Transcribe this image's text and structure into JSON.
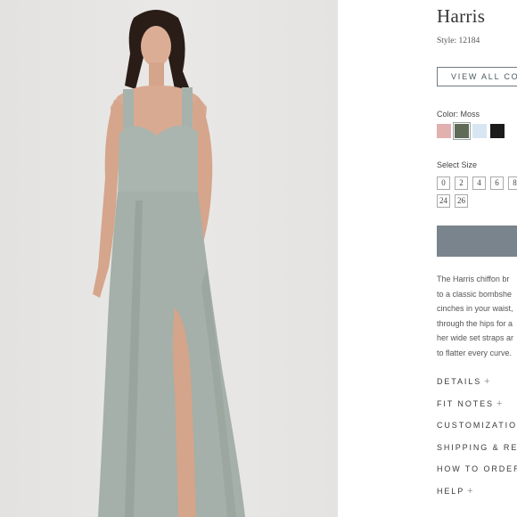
{
  "product": {
    "title": "Harris",
    "style": "Style: 12184",
    "view_button": "VIEW ALL CO",
    "color_label": "Color: Moss",
    "swatches": [
      {
        "name": "blush",
        "color": "#e2b0ae"
      },
      {
        "name": "moss",
        "color": "#5f6a57"
      },
      {
        "name": "light-blue",
        "color": "#d8e6f3"
      },
      {
        "name": "black",
        "color": "#1b1b1b"
      }
    ],
    "size_label": "Select Size",
    "sizes_row1": [
      "0",
      "2",
      "4",
      "6",
      "8"
    ],
    "sizes_row2": [
      "24",
      "26"
    ],
    "add_button_color": "#7a848c",
    "description_lines": [
      "The Harris chiffon br",
      "to a classic bombshe",
      "cinches in your waist,",
      "through the hips for a",
      "her wide set straps ar",
      "to flatter every curve."
    ],
    "accordion": [
      {
        "label": "DETAILS",
        "plus": "+"
      },
      {
        "label": "FIT NOTES",
        "plus": "+"
      },
      {
        "label": "CUSTOMIZATION",
        "plus": ""
      },
      {
        "label": "SHIPPING & RET",
        "plus": ""
      },
      {
        "label": "HOW TO ORDER",
        "plus": ""
      },
      {
        "label": "HELP",
        "plus": "+"
      }
    ]
  },
  "photo": {
    "background": "#e6e5e3",
    "dress_color": "#a6b2ab",
    "skin_color": "#d9aa92",
    "hair_color": "#2a1d18"
  }
}
